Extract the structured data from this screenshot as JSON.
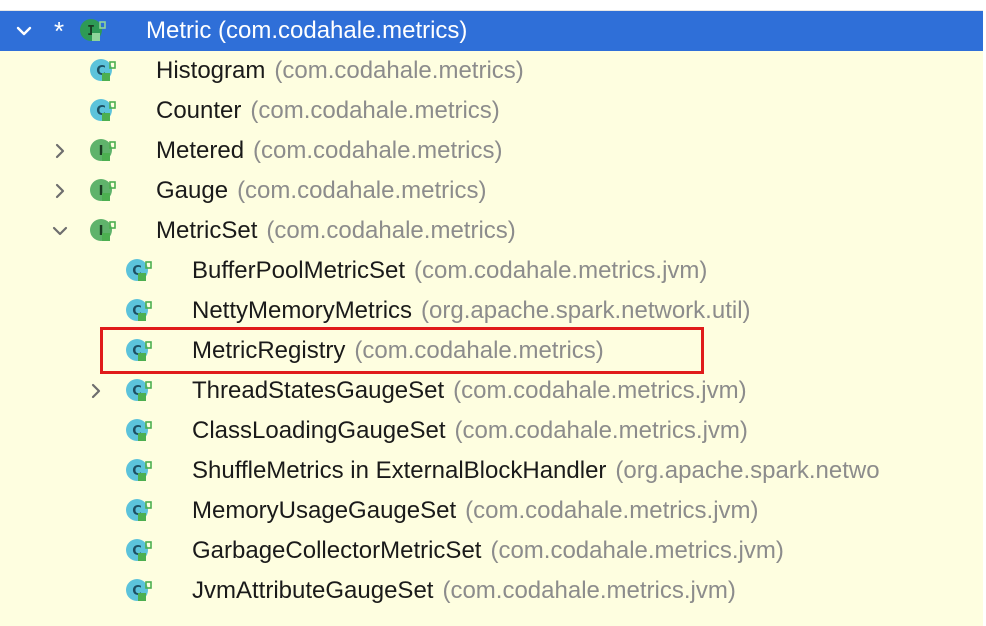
{
  "hierarchy": {
    "root": {
      "name": "Metric",
      "package": "(com.codahale.metrics)",
      "kind": "interface",
      "marker": "*",
      "expanded": true,
      "selected": true
    },
    "items": [
      {
        "name": "Histogram",
        "package": "(com.codahale.metrics)",
        "kind": "class",
        "expander": "none"
      },
      {
        "name": "Counter",
        "package": "(com.codahale.metrics)",
        "kind": "class",
        "expander": "none"
      },
      {
        "name": "Metered",
        "package": "(com.codahale.metrics)",
        "kind": "interface",
        "expander": "collapsed"
      },
      {
        "name": "Gauge",
        "package": "(com.codahale.metrics)",
        "kind": "interface",
        "expander": "collapsed"
      },
      {
        "name": "MetricSet",
        "package": "(com.codahale.metrics)",
        "kind": "interface",
        "expander": "expanded"
      },
      {
        "name": "BufferPoolMetricSet",
        "package": "(com.codahale.metrics.jvm)",
        "kind": "class",
        "expander": "none"
      },
      {
        "name": "NettyMemoryMetrics",
        "package": "(org.apache.spark.network.util)",
        "kind": "class",
        "expander": "none"
      },
      {
        "name": "MetricRegistry",
        "package": "(com.codahale.metrics)",
        "kind": "class",
        "expander": "none",
        "highlighted": true
      },
      {
        "name": "ThreadStatesGaugeSet",
        "package": "(com.codahale.metrics.jvm)",
        "kind": "class",
        "expander": "collapsed"
      },
      {
        "name": "ClassLoadingGaugeSet",
        "package": "(com.codahale.metrics.jvm)",
        "kind": "class",
        "expander": "none"
      },
      {
        "name": "ShuffleMetrics in ExternalBlockHandler",
        "package": "(org.apache.spark.netwo",
        "kind": "class",
        "expander": "none"
      },
      {
        "name": "MemoryUsageGaugeSet",
        "package": "(com.codahale.metrics.jvm)",
        "kind": "class",
        "expander": "none"
      },
      {
        "name": "GarbageCollectorMetricSet",
        "package": "(com.codahale.metrics.jvm)",
        "kind": "class",
        "expander": "none"
      },
      {
        "name": "JvmAttributeGaugeSet",
        "package": "(com.codahale.metrics.jvm)",
        "kind": "class",
        "expander": "none"
      }
    ]
  },
  "icons": {
    "class_letter": "C",
    "interface_letter": "I",
    "class_color": "#5cc3db",
    "interface_color": "#5fb36b",
    "interface_selected_color": "#2e9a55",
    "lock_color": "#4caf50",
    "lock_icon": "lock-open-icon",
    "expanded_icon": "chevron-down-icon",
    "collapsed_icon": "chevron-right-icon"
  },
  "colors": {
    "background": "#fefee0",
    "selection": "#2f6fd8",
    "highlight_border": "#e01b1b",
    "package_text": "#8c8c8c"
  }
}
